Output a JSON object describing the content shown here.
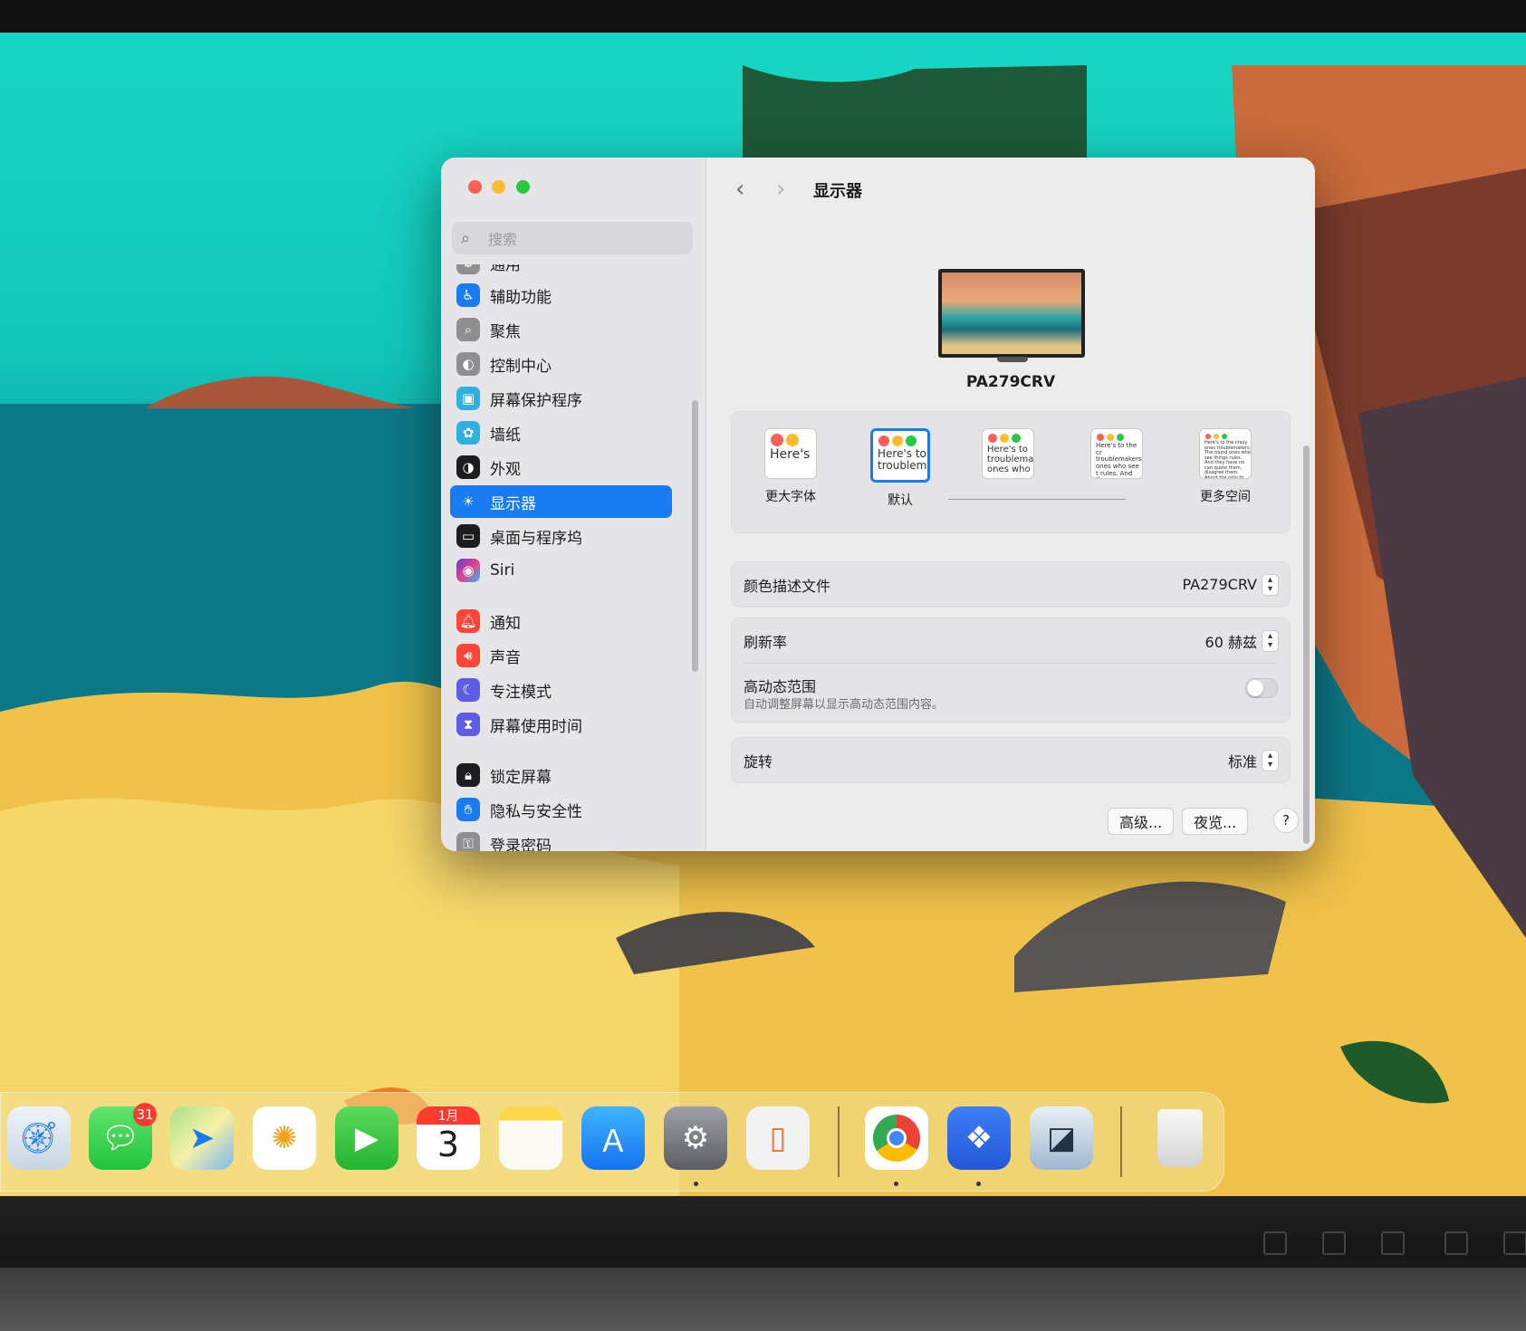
{
  "window": {
    "title": "显示器",
    "search_placeholder": "搜索"
  },
  "sidebar": {
    "items": [
      {
        "label": "通用",
        "icon": "gear-icon",
        "color": "#8e8e93"
      },
      {
        "label": "辅助功能",
        "icon": "accessibility-icon",
        "color": "#1a7cf2"
      },
      {
        "label": "聚焦",
        "icon": "magnifier-icon",
        "color": "#8e8e93"
      },
      {
        "label": "控制中心",
        "icon": "toggles-icon",
        "color": "#8e8e93"
      },
      {
        "label": "屏幕保护程序",
        "icon": "screensaver-icon",
        "color": "#30b0e0"
      },
      {
        "label": "墙纸",
        "icon": "flower-icon",
        "color": "#30b0e0"
      },
      {
        "label": "外观",
        "icon": "appearance-icon",
        "color": "#1d1d1f"
      },
      {
        "label": "显示器",
        "icon": "sun-icon",
        "color": "#1a7cf2",
        "selected": true
      },
      {
        "label": "桌面与程序坞",
        "icon": "dock-icon",
        "color": "#1d1d1f"
      },
      {
        "label": "Siri",
        "icon": "siri-icon",
        "color": "#5e3fd1"
      },
      {
        "label": "通知",
        "icon": "bell-icon",
        "color": "#ff453a"
      },
      {
        "label": "声音",
        "icon": "speaker-icon",
        "color": "#ff453a"
      },
      {
        "label": "专注模式",
        "icon": "moon-icon",
        "color": "#5e5ce6"
      },
      {
        "label": "屏幕使用时间",
        "icon": "hourglass-icon",
        "color": "#5e5ce6"
      },
      {
        "label": "锁定屏幕",
        "icon": "lock-icon",
        "color": "#1d1d1f"
      },
      {
        "label": "隐私与安全性",
        "icon": "hand-icon",
        "color": "#1a7cf2"
      },
      {
        "label": "登录密码",
        "icon": "key-icon",
        "color": "#8e8e93"
      }
    ]
  },
  "display": {
    "monitor_name": "PA279CRV",
    "resolution_options": [
      {
        "label": "更大字体",
        "preview": "Here's",
        "selected": false
      },
      {
        "label": "默认",
        "preview": "Here's to troublem",
        "selected": true
      },
      {
        "label": "",
        "preview": "Here's to troublema ones who",
        "selected": false
      },
      {
        "label": "",
        "preview": "Here's to the cr troublemakers. ones who see t rules. And they",
        "selected": false
      },
      {
        "label": "更多空间",
        "preview": "Here's to the crazy ones troublemakers. The round ones who see things rules. And they have no can quote them, disagree them. About the only th Because they change th",
        "selected": false
      }
    ],
    "color_profile": {
      "label": "颜色描述文件",
      "value": "PA279CRV"
    },
    "refresh_rate": {
      "label": "刷新率",
      "value": "60 赫兹"
    },
    "hdr": {
      "label": "高动态范围",
      "description": "自动调整屏幕以显示高动态范围内容。",
      "enabled": false
    },
    "rotation": {
      "label": "旋转",
      "value": "标准"
    },
    "buttons": {
      "advanced": "高级...",
      "night_shift": "夜览...",
      "help": "?"
    }
  },
  "dock": {
    "messages_badge": "31",
    "calendar_month": "1月",
    "calendar_day": "3",
    "apps": [
      "safari",
      "messages",
      "maps",
      "photos",
      "facetime",
      "calendar",
      "notes",
      "app-store",
      "system-settings",
      "iphone-mirroring",
      "chrome",
      "app",
      "preview",
      "trash"
    ]
  }
}
